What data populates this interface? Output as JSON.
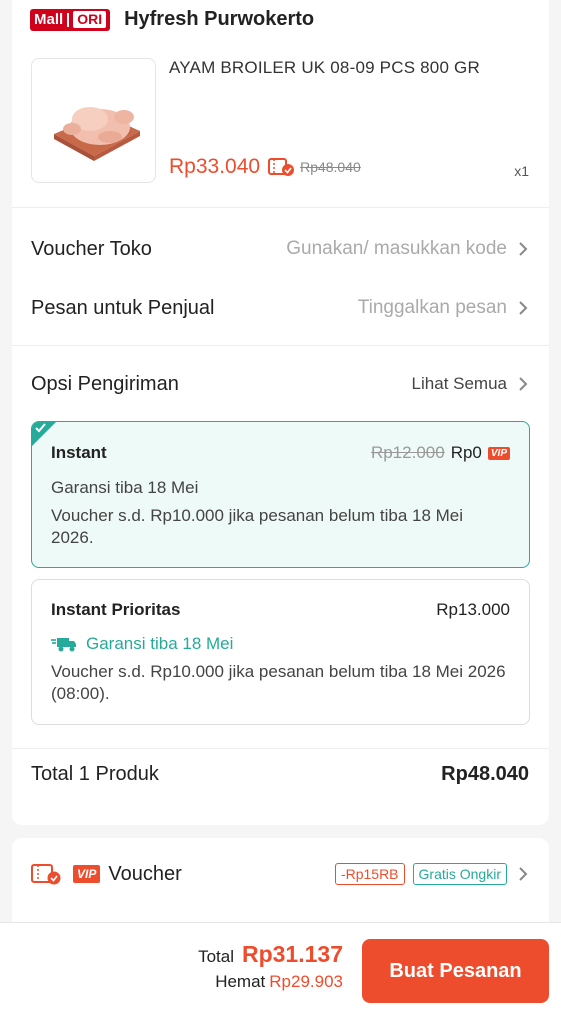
{
  "store": {
    "mall_label": "Mall",
    "ori_label": "ORI",
    "name": "Hyfresh Purwokerto"
  },
  "product": {
    "name": "AYAM BROILER UK 08-09 PCS 800 GR",
    "price": "Rp33.040",
    "original_price": "Rp48.040",
    "quantity": "x1",
    "image_icon": "raw-chicken-image"
  },
  "voucher_toko": {
    "label": "Voucher Toko",
    "hint": "Gunakan/ masukkan kode"
  },
  "message": {
    "label": "Pesan untuk Penjual",
    "placeholder": "Tinggalkan pesan"
  },
  "shipping": {
    "label": "Opsi Pengiriman",
    "see_all": "Lihat Semua",
    "options": [
      {
        "name": "Instant",
        "original_price": "Rp12.000",
        "price": "Rp0",
        "badge": "VIP",
        "guarantee": "Garansi tiba 18 Mei",
        "note": "Voucher s.d.  Rp10.000 jika pesanan belum tiba 18 Mei 2026.",
        "selected": true
      },
      {
        "name": "Instant Prioritas",
        "price": "Rp13.000",
        "guarantee": "Garansi tiba 18 Mei",
        "note": "Voucher s.d. Rp10.000 jika pesanan belum tiba 18 Mei 2026 (08:00).",
        "selected": false
      }
    ]
  },
  "total_products": {
    "label": "Total 1 Produk",
    "value": "Rp48.040"
  },
  "voucher": {
    "badge": "VIP",
    "label": "Voucher",
    "tag_discount": "-Rp15RB",
    "tag_shipping": "Gratis Ongkir"
  },
  "footer": {
    "total_label": "Total",
    "total_value": "Rp31.137",
    "savings_label": "Hemat",
    "savings_value": "Rp29.903",
    "order_button": "Buat Pesanan"
  },
  "colors": {
    "accent": "#ee4d2d",
    "teal": "#26aa99",
    "mall_red": "#d0011b"
  }
}
